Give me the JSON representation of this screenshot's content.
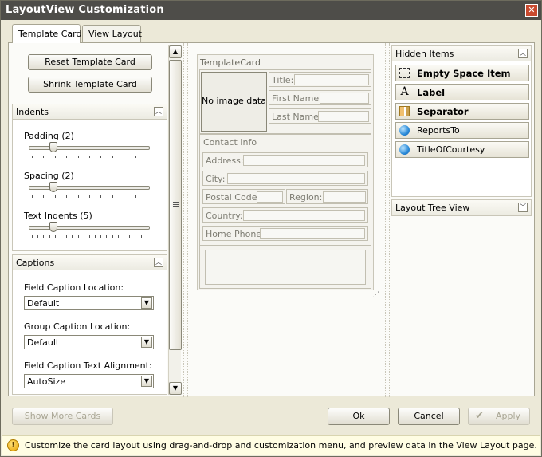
{
  "window": {
    "title": "LayoutView Customization",
    "close_glyph": "✕"
  },
  "tabs": [
    {
      "label": "Template Card",
      "active": true
    },
    {
      "label": "View Layout",
      "active": false
    }
  ],
  "left": {
    "reset_button": "Reset Template Card",
    "shrink_button": "Shrink Template Card",
    "indents": {
      "header": "Indents",
      "padding_label": "Padding (2)",
      "spacing_label": "Spacing (2)",
      "text_indents_label": "Text Indents (5)"
    },
    "captions": {
      "header": "Captions",
      "field_caption_location_label": "Field Caption Location:",
      "field_caption_location_value": "Default",
      "group_caption_location_label": "Group Caption Location:",
      "group_caption_location_value": "Default",
      "field_caption_alignment_label": "Field Caption Text Alignment:",
      "field_caption_alignment_value": "AutoSize"
    }
  },
  "card": {
    "title": "TemplateCard",
    "no_image": "No image data",
    "title_field": "Title:",
    "first_name_field": "First Name:",
    "last_name_field": "Last Name:",
    "contact_group": "Contact Info",
    "address_field": "Address:",
    "city_field": "City:",
    "postal_code_field": "Postal Code:",
    "region_field": "Region:",
    "country_field": "Country:",
    "home_phone_field": "Home Phone:"
  },
  "right": {
    "hidden_items_header": "Hidden Items",
    "items": [
      {
        "label": "Empty Space Item",
        "icon": "empty-space-icon"
      },
      {
        "label": "Label",
        "icon": "label-icon",
        "glyph": "A"
      },
      {
        "label": "Separator",
        "icon": "separator-icon"
      },
      {
        "label": "ReportsTo",
        "icon": "field-icon"
      },
      {
        "label": "TitleOfCourtesy",
        "icon": "field-icon"
      }
    ],
    "tree_view_header": "Layout Tree View"
  },
  "footer": {
    "show_more_cards": "Show More Cards",
    "ok": "Ok",
    "cancel": "Cancel",
    "apply": "Apply"
  },
  "status": {
    "message": "Customize the card layout using drag-and-drop and customization menu, and preview data in the View Layout page."
  }
}
